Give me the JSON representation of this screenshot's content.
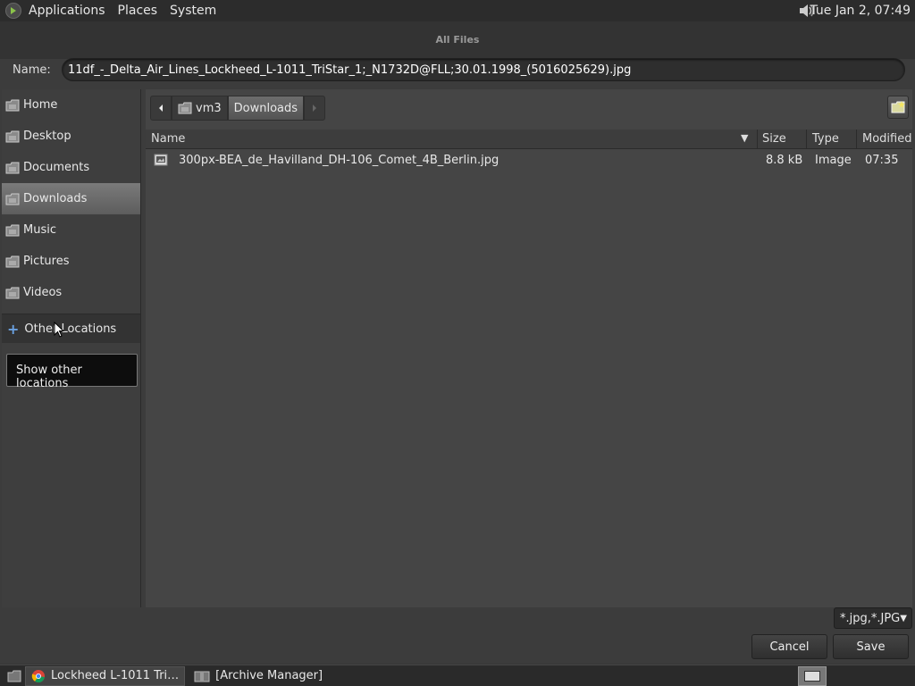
{
  "top_panel": {
    "menus": [
      "Applications",
      "Places",
      "System"
    ],
    "clock": "Tue Jan  2, 07:49"
  },
  "dialog": {
    "title": "All Files",
    "name_label": "Name:",
    "name_value": "11df_-_Delta_Air_Lines_Lockheed_L-1011_TriStar_1;_N1732D@FLL;30.01.1998_(5016025629).jpg"
  },
  "sidebar": {
    "places": [
      "Home",
      "Desktop",
      "Documents",
      "Downloads",
      "Music",
      "Pictures",
      "Videos"
    ],
    "selected": "Downloads",
    "other_locations": "Other Locations",
    "tooltip": "Show other locations"
  },
  "pathbar": {
    "segments": [
      "vm3",
      "Downloads"
    ]
  },
  "list": {
    "columns": {
      "name": "Name",
      "size": "Size",
      "type": "Type",
      "modified": "Modified"
    },
    "files": [
      {
        "name": "300px-BEA_de_Havilland_DH-106_Comet_4B_Berlin.jpg",
        "size": "8.8 kB",
        "type": "Image",
        "modified": "07:35"
      }
    ]
  },
  "filter": {
    "value": "*.jpg,*.JPG"
  },
  "buttons": {
    "cancel": "Cancel",
    "save": "Save"
  },
  "taskbar": {
    "tasks": [
      "Lockheed L-1011 Tri…",
      "[Archive Manager]"
    ]
  },
  "icons": {
    "logo": "app-menu-icon",
    "volume": "volume-icon",
    "folder": "folder-icon",
    "plus": "plus-icon",
    "new_folder": "new-folder-icon",
    "image_file": "image-file-icon",
    "chrome": "chrome-icon",
    "archive": "archive-icon"
  },
  "colors": {
    "selected_bg": "#6a6a6a",
    "accent_plus": "#6aa0e0"
  }
}
